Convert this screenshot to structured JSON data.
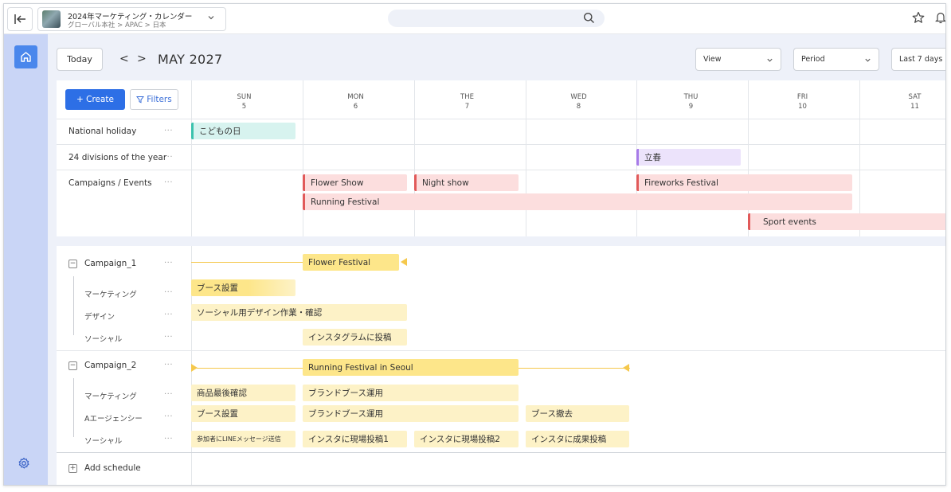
{
  "project": {
    "title": "2024年マーケティング・カレンダー",
    "breadcrumb": "グローバル本社 > APAC > 日本"
  },
  "toolbar": {
    "today_label": "Today",
    "prev_label": "<",
    "next_label": ">",
    "month_label": "MAY 2027",
    "view_label": "View",
    "period_label": "Period",
    "range_label": "Last 7 days"
  },
  "actions": {
    "create_label": "+ Create",
    "filters_label": "Filters"
  },
  "days": [
    {
      "dow": "SUN",
      "date": "5"
    },
    {
      "dow": "MON",
      "date": "6"
    },
    {
      "dow": "THE",
      "date": "7"
    },
    {
      "dow": "WED",
      "date": "8"
    },
    {
      "dow": "THU",
      "date": "9"
    },
    {
      "dow": "FRI",
      "date": "10"
    },
    {
      "dow": "SAT",
      "date": "11"
    }
  ],
  "rows": {
    "holiday": "National holiday",
    "divisions": "24 divisions of the year",
    "campaigns": "Campaigns / Events"
  },
  "events": {
    "kodomo": "こどもの日",
    "risshun": "立春",
    "flower_show": "Flower Show",
    "night_show": "Night show",
    "fireworks": "Fireworks Festival",
    "running": "Running Festival",
    "sport": "Sport events"
  },
  "campaign1": {
    "name": "Campaign_1",
    "milestone": "Flower Festival",
    "sub_marketing": "マーケティング",
    "sub_design": "デザイン",
    "sub_social": "ソーシャル",
    "task_booth": "ブース設置",
    "task_design": "ソーシャル用デザイン作業・確認",
    "task_insta": "インスタグラムに投稿"
  },
  "campaign2": {
    "name": "Campaign_2",
    "milestone": "Running Festival in Seoul",
    "sub_marketing": "マーケティング",
    "sub_agency": "Aエージェンシー",
    "sub_social": "ソーシャル",
    "task_product": "商品最後確認",
    "task_brand1": "ブランドブース運用",
    "task_booth": "ブース設置",
    "task_brand2": "ブランドブース運用",
    "task_remove": "ブース撤去",
    "task_line": "参加者にLINEメッセージ送信",
    "task_post1": "インスタに現場投稿1",
    "task_post2": "インスタに現場投稿2",
    "task_result": "インスタに成果投稿"
  },
  "footer": {
    "add_label": "Add schedule"
  },
  "row_menu": "···"
}
